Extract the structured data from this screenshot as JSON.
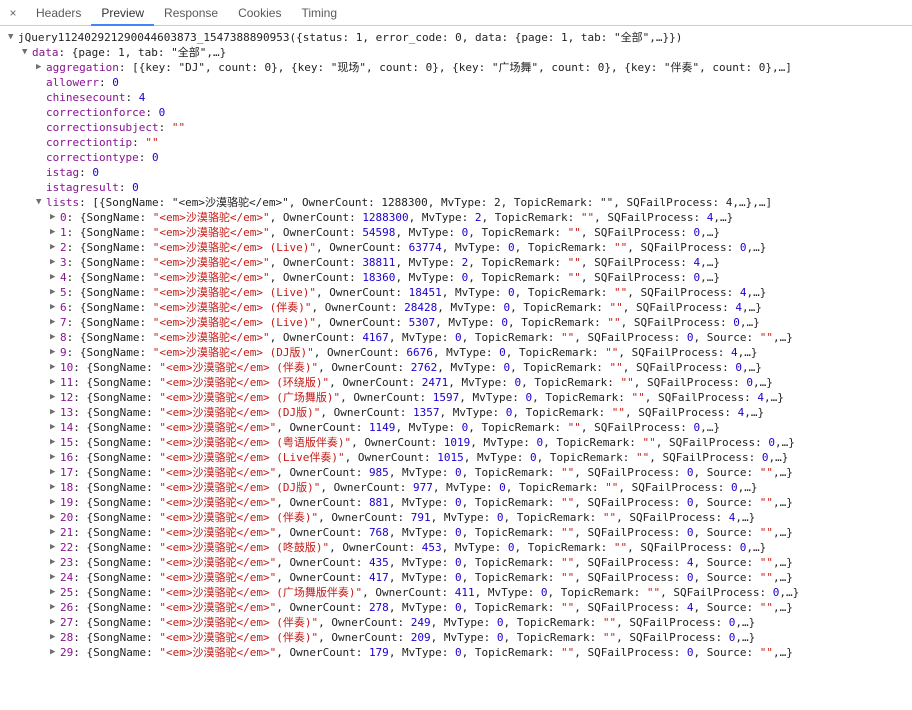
{
  "tabs": {
    "close": "×",
    "headers": "Headers",
    "preview": "Preview",
    "response": "Response",
    "cookies": "Cookies",
    "timing": "Timing"
  },
  "callback_name": "jQuery112402921290044603873_1547388890953",
  "callback_summary": "({status: 1, error_code: 0, data: {page: 1, tab: \"全部\",…}})",
  "data_label": "data",
  "data_summary": "{page: 1, tab: \"全部\",…}",
  "fields": {
    "aggregation": {
      "label": "aggregation",
      "summary": "[{key: \"DJ\", count: 0}, {key: \"现场\", count: 0}, {key: \"广场舞\", count: 0}, {key: \"伴奏\", count: 0},…]"
    },
    "allowerr": {
      "label": "allowerr",
      "value": 0
    },
    "chinesecount": {
      "label": "chinesecount",
      "value": 4
    },
    "correctionforce": {
      "label": "correctionforce",
      "value": 0
    },
    "correctionsubject": {
      "label": "correctionsubject",
      "value": "\"\""
    },
    "correctiontip": {
      "label": "correctiontip",
      "value": "\"\""
    },
    "correctiontype": {
      "label": "correctiontype",
      "value": 0
    },
    "istag": {
      "label": "istag",
      "value": 0
    },
    "istagresult": {
      "label": "istagresult",
      "value": 0
    }
  },
  "lists_label": "lists",
  "lists_summary": "[{SongName: \"<em>沙漠骆驼</em>\", OwnerCount: 1288300, MvType: 2, TopicRemark: \"\", SQFailProcess: 4,…},…]",
  "lists": [
    {
      "idx": "0",
      "SongName": "<em>沙漠骆驼</em>",
      "OwnerCount": 1288300,
      "MvType": 2,
      "TopicRemark": "",
      "SQFailProcess": 4,
      "tail": ",…}"
    },
    {
      "idx": "1",
      "SongName": "<em>沙漠骆驼</em>",
      "OwnerCount": 54598,
      "MvType": 0,
      "TopicRemark": "",
      "SQFailProcess": 0,
      "tail": ",…}"
    },
    {
      "idx": "2",
      "SongName": "<em>沙漠骆驼</em> (Live)",
      "OwnerCount": 63774,
      "MvType": 0,
      "TopicRemark": "",
      "SQFailProcess": 0,
      "tail": ",…}"
    },
    {
      "idx": "3",
      "SongName": "<em>沙漠骆驼</em>",
      "OwnerCount": 38811,
      "MvType": 2,
      "TopicRemark": "",
      "SQFailProcess": 4,
      "tail": ",…}"
    },
    {
      "idx": "4",
      "SongName": "<em>沙漠骆驼</em>",
      "OwnerCount": 18360,
      "MvType": 0,
      "TopicRemark": "",
      "SQFailProcess": 0,
      "tail": ",…}"
    },
    {
      "idx": "5",
      "SongName": "<em>沙漠骆驼</em> (Live)",
      "OwnerCount": 18451,
      "MvType": 0,
      "TopicRemark": "",
      "SQFailProcess": 4,
      "tail": ",…}"
    },
    {
      "idx": "6",
      "SongName": "<em>沙漠骆驼</em> (伴奏)",
      "OwnerCount": 28428,
      "MvType": 0,
      "TopicRemark": "",
      "SQFailProcess": 4,
      "tail": ",…}"
    },
    {
      "idx": "7",
      "SongName": "<em>沙漠骆驼</em> (Live)",
      "OwnerCount": 5307,
      "MvType": 0,
      "TopicRemark": "",
      "SQFailProcess": 0,
      "tail": ",…}"
    },
    {
      "idx": "8",
      "SongName": "<em>沙漠骆驼</em>",
      "OwnerCount": 4167,
      "MvType": 0,
      "TopicRemark": "",
      "SQFailProcess": 0,
      "Source": "",
      "tail": ",…}"
    },
    {
      "idx": "9",
      "SongName": "<em>沙漠骆驼</em> (DJ版)",
      "OwnerCount": 6676,
      "MvType": 0,
      "TopicRemark": "",
      "SQFailProcess": 4,
      "tail": ",…}"
    },
    {
      "idx": "10",
      "SongName": "<em>沙漠骆驼</em> (伴奏)",
      "OwnerCount": 2762,
      "MvType": 0,
      "TopicRemark": "",
      "SQFailProcess": 0,
      "tail": ",…}"
    },
    {
      "idx": "11",
      "SongName": "<em>沙漠骆驼</em> (环绕版)",
      "OwnerCount": 2471,
      "MvType": 0,
      "TopicRemark": "",
      "SQFailProcess": 0,
      "tail": ",…}"
    },
    {
      "idx": "12",
      "SongName": "<em>沙漠骆驼</em> (广场舞版)",
      "OwnerCount": 1597,
      "MvType": 0,
      "TopicRemark": "",
      "SQFailProcess": 4,
      "tail": ",…}"
    },
    {
      "idx": "13",
      "SongName": "<em>沙漠骆驼</em> (DJ版)",
      "OwnerCount": 1357,
      "MvType": 0,
      "TopicRemark": "",
      "SQFailProcess": 4,
      "tail": ",…}"
    },
    {
      "idx": "14",
      "SongName": "<em>沙漠骆驼</em>",
      "OwnerCount": 1149,
      "MvType": 0,
      "TopicRemark": "",
      "SQFailProcess": 0,
      "tail": ",…}"
    },
    {
      "idx": "15",
      "SongName": "<em>沙漠骆驼</em> (粤语版伴奏)",
      "OwnerCount": 1019,
      "MvType": 0,
      "TopicRemark": "",
      "SQFailProcess": 0,
      "tail": ",…}"
    },
    {
      "idx": "16",
      "SongName": "<em>沙漠骆驼</em> (Live伴奏)",
      "OwnerCount": 1015,
      "MvType": 0,
      "TopicRemark": "",
      "SQFailProcess": 0,
      "tail": ",…}"
    },
    {
      "idx": "17",
      "SongName": "<em>沙漠骆驼</em>",
      "OwnerCount": 985,
      "MvType": 0,
      "TopicRemark": "",
      "SQFailProcess": 0,
      "Source": "",
      "tail": ",…}"
    },
    {
      "idx": "18",
      "SongName": "<em>沙漠骆驼</em> (DJ版)",
      "OwnerCount": 977,
      "MvType": 0,
      "TopicRemark": "",
      "SQFailProcess": 0,
      "tail": ",…}"
    },
    {
      "idx": "19",
      "SongName": "<em>沙漠骆驼</em>",
      "OwnerCount": 881,
      "MvType": 0,
      "TopicRemark": "",
      "SQFailProcess": 0,
      "Source": "",
      "tail": ",…}"
    },
    {
      "idx": "20",
      "SongName": "<em>沙漠骆驼</em> (伴奏)",
      "OwnerCount": 791,
      "MvType": 0,
      "TopicRemark": "",
      "SQFailProcess": 4,
      "tail": ",…}"
    },
    {
      "idx": "21",
      "SongName": "<em>沙漠骆驼</em>",
      "OwnerCount": 768,
      "MvType": 0,
      "TopicRemark": "",
      "SQFailProcess": 0,
      "Source": "",
      "tail": ",…}"
    },
    {
      "idx": "22",
      "SongName": "<em>沙漠骆驼</em> (咚鼓版)",
      "OwnerCount": 453,
      "MvType": 0,
      "TopicRemark": "",
      "SQFailProcess": 0,
      "tail": ",…}"
    },
    {
      "idx": "23",
      "SongName": "<em>沙漠骆驼</em>",
      "OwnerCount": 435,
      "MvType": 0,
      "TopicRemark": "",
      "SQFailProcess": 4,
      "Source": "",
      "tail": ",…}"
    },
    {
      "idx": "24",
      "SongName": "<em>沙漠骆驼</em>",
      "OwnerCount": 417,
      "MvType": 0,
      "TopicRemark": "",
      "SQFailProcess": 0,
      "Source": "",
      "tail": ",…}"
    },
    {
      "idx": "25",
      "SongName": "<em>沙漠骆驼</em> (广场舞版伴奏)",
      "OwnerCount": 411,
      "MvType": 0,
      "TopicRemark": "",
      "SQFailProcess": 0,
      "tail": ",…}"
    },
    {
      "idx": "26",
      "SongName": "<em>沙漠骆驼</em>",
      "OwnerCount": 278,
      "MvType": 0,
      "TopicRemark": "",
      "SQFailProcess": 4,
      "Source": "",
      "tail": ",…}"
    },
    {
      "idx": "27",
      "SongName": "<em>沙漠骆驼</em> (伴奏)",
      "OwnerCount": 249,
      "MvType": 0,
      "TopicRemark": "",
      "SQFailProcess": 0,
      "tail": ",…}"
    },
    {
      "idx": "28",
      "SongName": "<em>沙漠骆驼</em> (伴奏)",
      "OwnerCount": 209,
      "MvType": 0,
      "TopicRemark": "",
      "SQFailProcess": 0,
      "tail": ",…}"
    },
    {
      "idx": "29",
      "SongName": "<em>沙漠骆驼</em>",
      "OwnerCount": 179,
      "MvType": 0,
      "TopicRemark": "",
      "SQFailProcess": 0,
      "Source": "",
      "tail": ",…}"
    }
  ]
}
